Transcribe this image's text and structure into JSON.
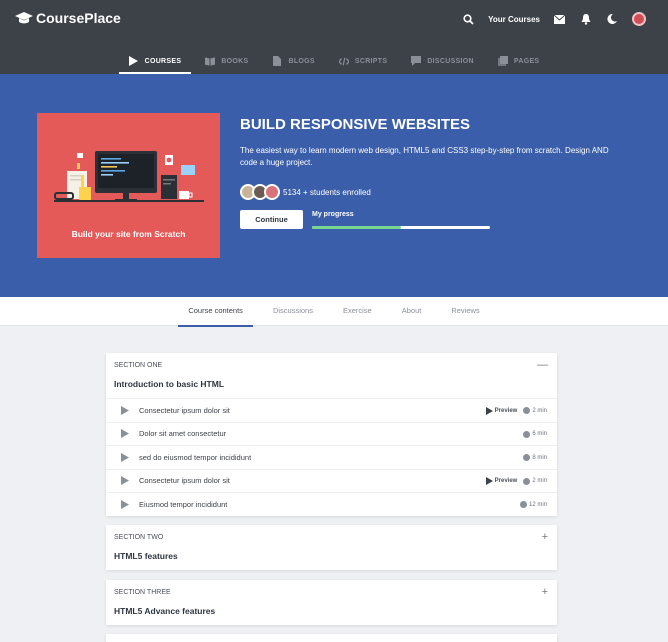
{
  "header": {
    "brand": "CoursePlace",
    "your_courses": "Your Courses"
  },
  "nav": [
    {
      "label": "COURSES",
      "icon": "play-icon",
      "active": true
    },
    {
      "label": "BOOKS",
      "icon": "book-icon"
    },
    {
      "label": "BLOGS",
      "icon": "document-icon"
    },
    {
      "label": "SCRIPTS",
      "icon": "code-icon"
    },
    {
      "label": "DISCUSSION",
      "icon": "chat-icon"
    },
    {
      "label": "PAGES",
      "icon": "pages-icon"
    }
  ],
  "hero": {
    "thumb_caption": "Build your site from Scratch",
    "title": "BUILD RESPONSIVE WEBSITES",
    "description": "The easiest way to learn modern web design, HTML5 and CSS3 step-by-step from scratch. Design AND code a huge project.",
    "students": "5134 + students enrolled",
    "continue_label": "Continue",
    "progress_label": "My progress",
    "progress_fraction": 0.5
  },
  "tabs": [
    "Course contents",
    "Discussions",
    "Exercise",
    "About",
    "Reviews"
  ],
  "sections": [
    {
      "label": "SECTION ONE",
      "title": "Introduction to basic HTML",
      "toggle": "—",
      "lessons": [
        {
          "title": "Consectetur ipsum dolor sit",
          "preview": "Preview",
          "duration": "2 min"
        },
        {
          "title": "Dolor sit amet consectetur",
          "preview": "",
          "duration": "6 min"
        },
        {
          "title": "sed do eiusmod tempor incididunt",
          "preview": "",
          "duration": "8 min"
        },
        {
          "title": "Consectetur ipsum dolor sit",
          "preview": "Preview",
          "duration": "2 min"
        },
        {
          "title": "Eiusmod tempor incididunt",
          "preview": "",
          "duration": "12 min"
        }
      ]
    },
    {
      "label": "SECTION TWO",
      "title": "HTML5 features",
      "toggle": "+"
    },
    {
      "label": "SECTION THREE",
      "title": "HTML5 Advance features",
      "toggle": "+"
    }
  ],
  "colors": {
    "hero_bg": "#3a5ea9",
    "header_bg": "#3d4249",
    "thumb_bg": "#e35a58",
    "progress": "#78d68e"
  }
}
